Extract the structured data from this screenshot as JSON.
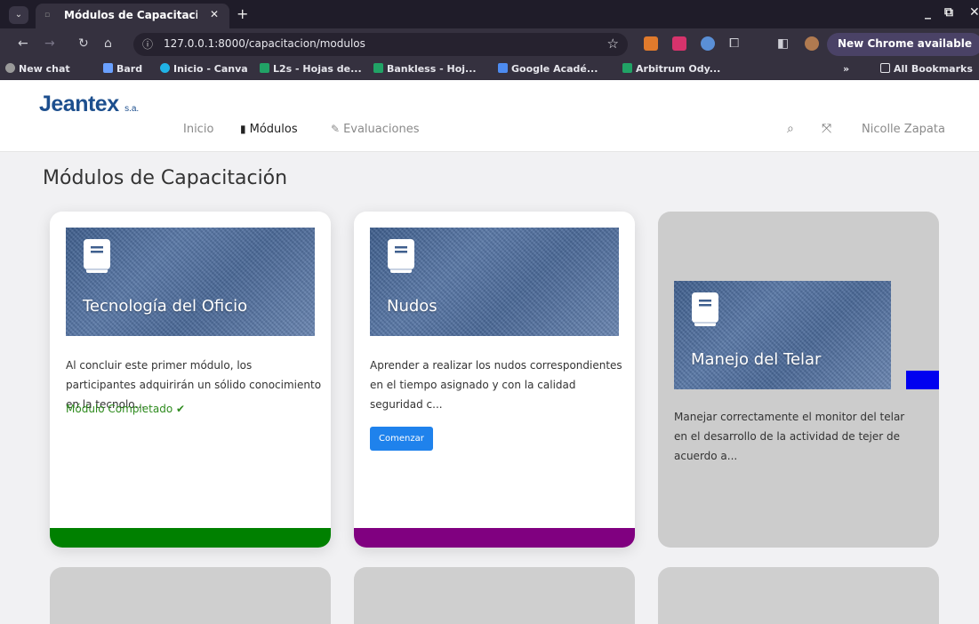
{
  "browser": {
    "tab_title": "Módulos de Capacitació",
    "url": "127.0.0.1:8000/capacitacion/modulos",
    "new_chrome_label": "New Chrome available",
    "bookmarks": [
      {
        "label": "New chat",
        "color": "#9a9a9a"
      },
      {
        "label": "Bard",
        "color": "#6aa0ff"
      },
      {
        "label": "Inicio - Canva",
        "color": "#20b3e6"
      },
      {
        "label": "L2s - Hojas de...",
        "color": "#21a366"
      },
      {
        "label": "Bankless - Hoj...",
        "color": "#21a366"
      },
      {
        "label": "Google Acadé...",
        "color": "#4d8bf0"
      },
      {
        "label": "Arbitrum Ody...",
        "color": "#21a366"
      }
    ],
    "bookmarks_overflow": "»",
    "all_bookmarks": "All Bookmarks"
  },
  "app": {
    "logo": "Jeantex",
    "logo_suffix": "s.a.",
    "nav": {
      "inicio": "Inicio",
      "modulos": "Módulos",
      "evaluaciones": "Evaluaciones"
    },
    "user_name": "Nicolle Zapata"
  },
  "page": {
    "title": "Módulos de Capacitación"
  },
  "modules": [
    {
      "title": "Tecnología del Oficio",
      "description": "Al concluir este primer módulo, los participantes adquirirán un sólido conocimiento en la tecnolo...",
      "status": "Módulo Completado",
      "bar_color": "#008000"
    },
    {
      "title": "Nudos",
      "description": "Aprender a realizar los nudos correspondientes en el tiempo asignado y con la calidad seguridad c...",
      "button_label": "Comenzar",
      "bar_color": "#800080"
    },
    {
      "title": "Manejo del Telar",
      "description": "Manejar correctamente el monitor del telar en el desarrollo de la actividad de tejer de acuerdo a..."
    }
  ]
}
